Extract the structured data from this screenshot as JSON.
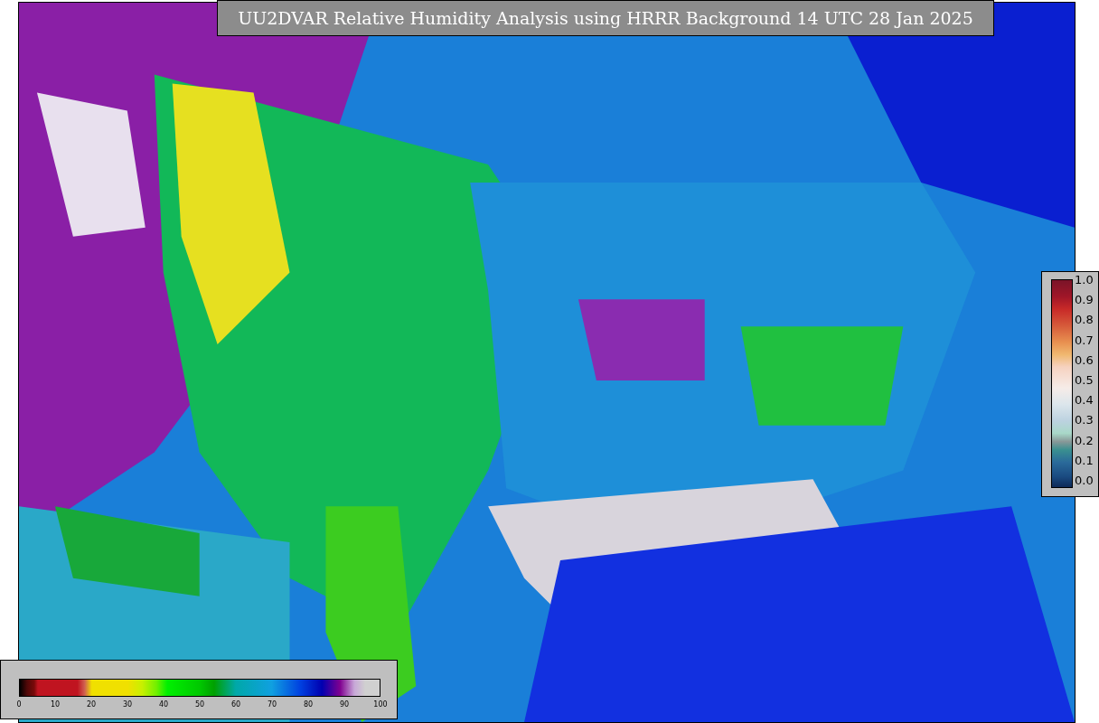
{
  "title": "UU2DVAR Relative Humidity Analysis using HRRR Background 14 UTC 28 Jan 2025",
  "station_colorbar": {
    "ticks": [
      "1.0",
      "0.9",
      "0.8",
      "0.7",
      "0.6",
      "0.5",
      "0.4",
      "0.3",
      "0.2",
      "0.1",
      "0.0"
    ]
  },
  "humidity_colorbar": {
    "ticks": [
      "0",
      "10",
      "20",
      "30",
      "40",
      "50",
      "60",
      "70",
      "80",
      "90",
      "100"
    ]
  }
}
